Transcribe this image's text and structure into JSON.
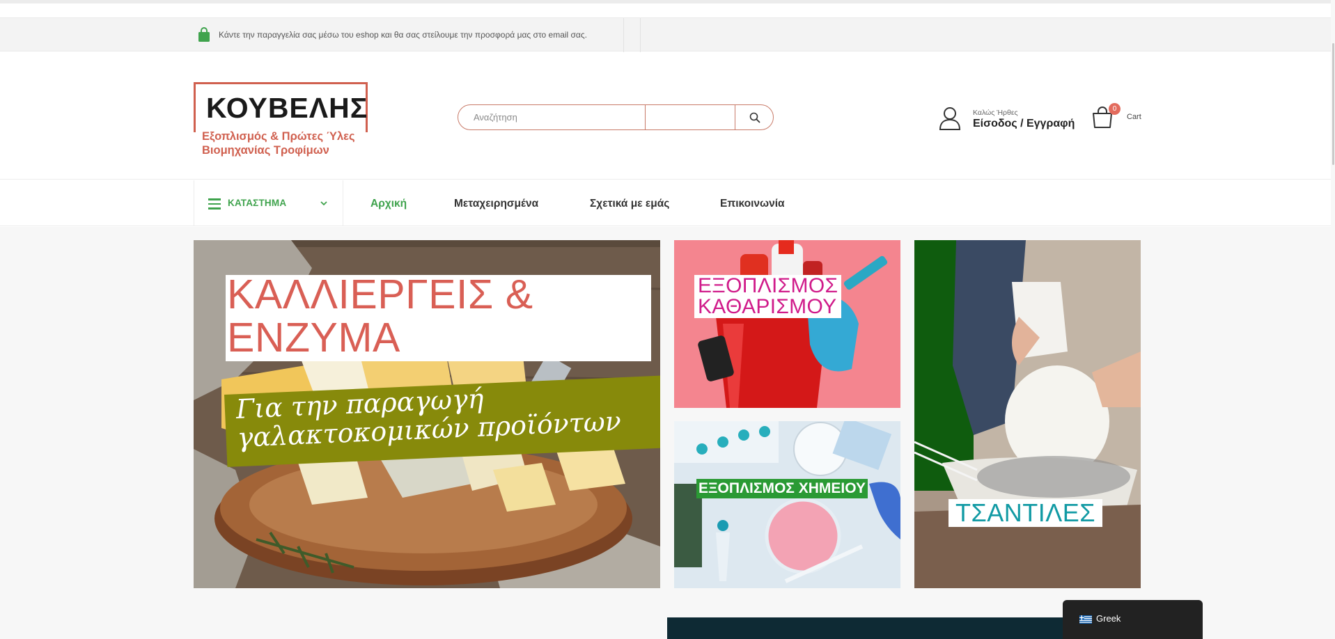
{
  "topbar": {
    "notice": "Κάντε την παραγγελία σας μέσω του eshop και θα σας στείλουμε την προσφορά μας στο email σας.",
    "icon": "shopping-bag-icon",
    "icon_color": "#3fa34d"
  },
  "logo": {
    "title": "ΚΟΥΒΕΛΗΣ",
    "subtitle_line1": "Εξοπλισμός & Πρώτες Ύλες",
    "subtitle_line2": "Βιομηχανίας Τροφίμων",
    "accent_color": "#d0604f"
  },
  "search": {
    "placeholder": "Αναζήτηση",
    "category_value": "",
    "button_icon": "search-icon"
  },
  "account": {
    "greeting": "Καλώς Ήρθες",
    "login_label": "Είσοδος / Εγγραφή",
    "icon": "user-icon"
  },
  "cart": {
    "count": "0",
    "label": "Cart",
    "icon": "shopping-bag-icon",
    "badge_color": "#e36b5d"
  },
  "nav": {
    "category_menu_label": "ΚΑΤΑΣΤΗΜΑ",
    "items": [
      {
        "label": "Αρχική",
        "active": true
      },
      {
        "label": "Μεταχειρησμένα",
        "active": false
      },
      {
        "label": "Σχετικά με εμάς",
        "active": false
      },
      {
        "label": "Επικοινωνία",
        "active": false
      }
    ],
    "accent_color": "#3fa34d"
  },
  "banners": {
    "cheese": {
      "headline_line1": "ΚΑΛΛΙΕΡΓΕΙΣ &",
      "headline_line2": "ΕΝΖΥΜΑ",
      "sub_line1": "Για την παραγωγή",
      "sub_line2": "γαλακτοκομικών προϊόντων"
    },
    "cleaning": {
      "line1": "ΕΞΟΠΛΙΣΜΟΣ",
      "line2": "ΚΑΘΑΡΙΣΜΟΥ"
    },
    "lab": {
      "label": "ΕΞΟΠΛΙΣΜΟΣ ΧΗΜΕΙΟΥ"
    },
    "bags": {
      "label": "ΤΣΑΝΤΙΛΕΣ"
    }
  },
  "language": {
    "label": "Greek",
    "flag": "greek-flag-icon"
  }
}
